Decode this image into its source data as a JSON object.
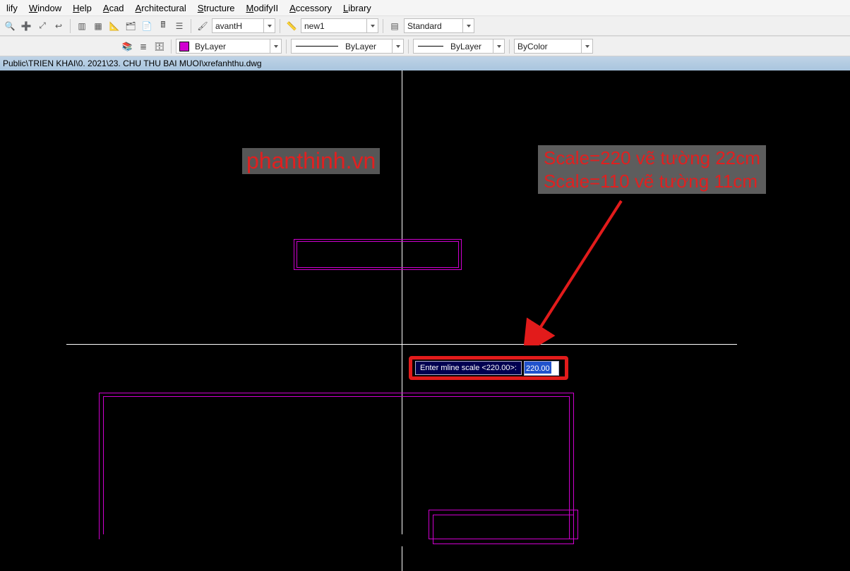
{
  "menu": {
    "items": [
      "lify",
      "Window",
      "Help",
      "Acad",
      "Architectural",
      "Structure",
      "ModifyII",
      "Accessory",
      "Library"
    ]
  },
  "toolbar1": {
    "styleDD": "avantH",
    "dimDD": "new1",
    "tableDD": "Standard"
  },
  "toolbar2": {
    "layerDD": "ByLayer",
    "ltypeDD": "ByLayer",
    "lweightDD": "ByLayer",
    "colorDD": "ByColor"
  },
  "titlebar": {
    "path": "Public\\TRIEN KHAI\\0. 2021\\23. CHU THU BAI MUOI\\xrefanhthu.dwg"
  },
  "canvas": {
    "watermark": "phanthinh.vn",
    "note_line1": "Scale=220 vẽ tường 22cm",
    "note_line2": "Scale=110 vẽ tường 11cm",
    "cmd_label": "Enter mline scale <220.00>:",
    "cmd_value": "220.00"
  }
}
